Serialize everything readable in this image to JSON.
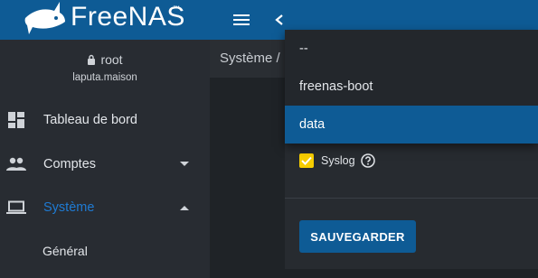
{
  "brand": {
    "name": "FreeNAS",
    "trademark": "™"
  },
  "user": {
    "name": "root",
    "host": "laputa.maison"
  },
  "sidebar": {
    "items": [
      {
        "label": "Tableau de bord",
        "icon": "dashboard-icon"
      },
      {
        "label": "Comptes",
        "icon": "people-icon"
      },
      {
        "label": "Système",
        "icon": "laptop-icon"
      }
    ],
    "sub_items": [
      {
        "label": "Général"
      }
    ]
  },
  "breadcrumb": {
    "text": "Système /"
  },
  "dropdown": {
    "options": [
      {
        "label": "--"
      },
      {
        "label": "freenas-boot"
      },
      {
        "label": "data"
      }
    ],
    "selected": "data"
  },
  "form": {
    "syslog_label": "Syslog",
    "syslog_checked": true,
    "save_label": "SAUVEGARDER"
  },
  "colors": {
    "accent": "#0e5b95",
    "active_nav": "#1f7bd3",
    "checkbox": "#f6cd00"
  }
}
